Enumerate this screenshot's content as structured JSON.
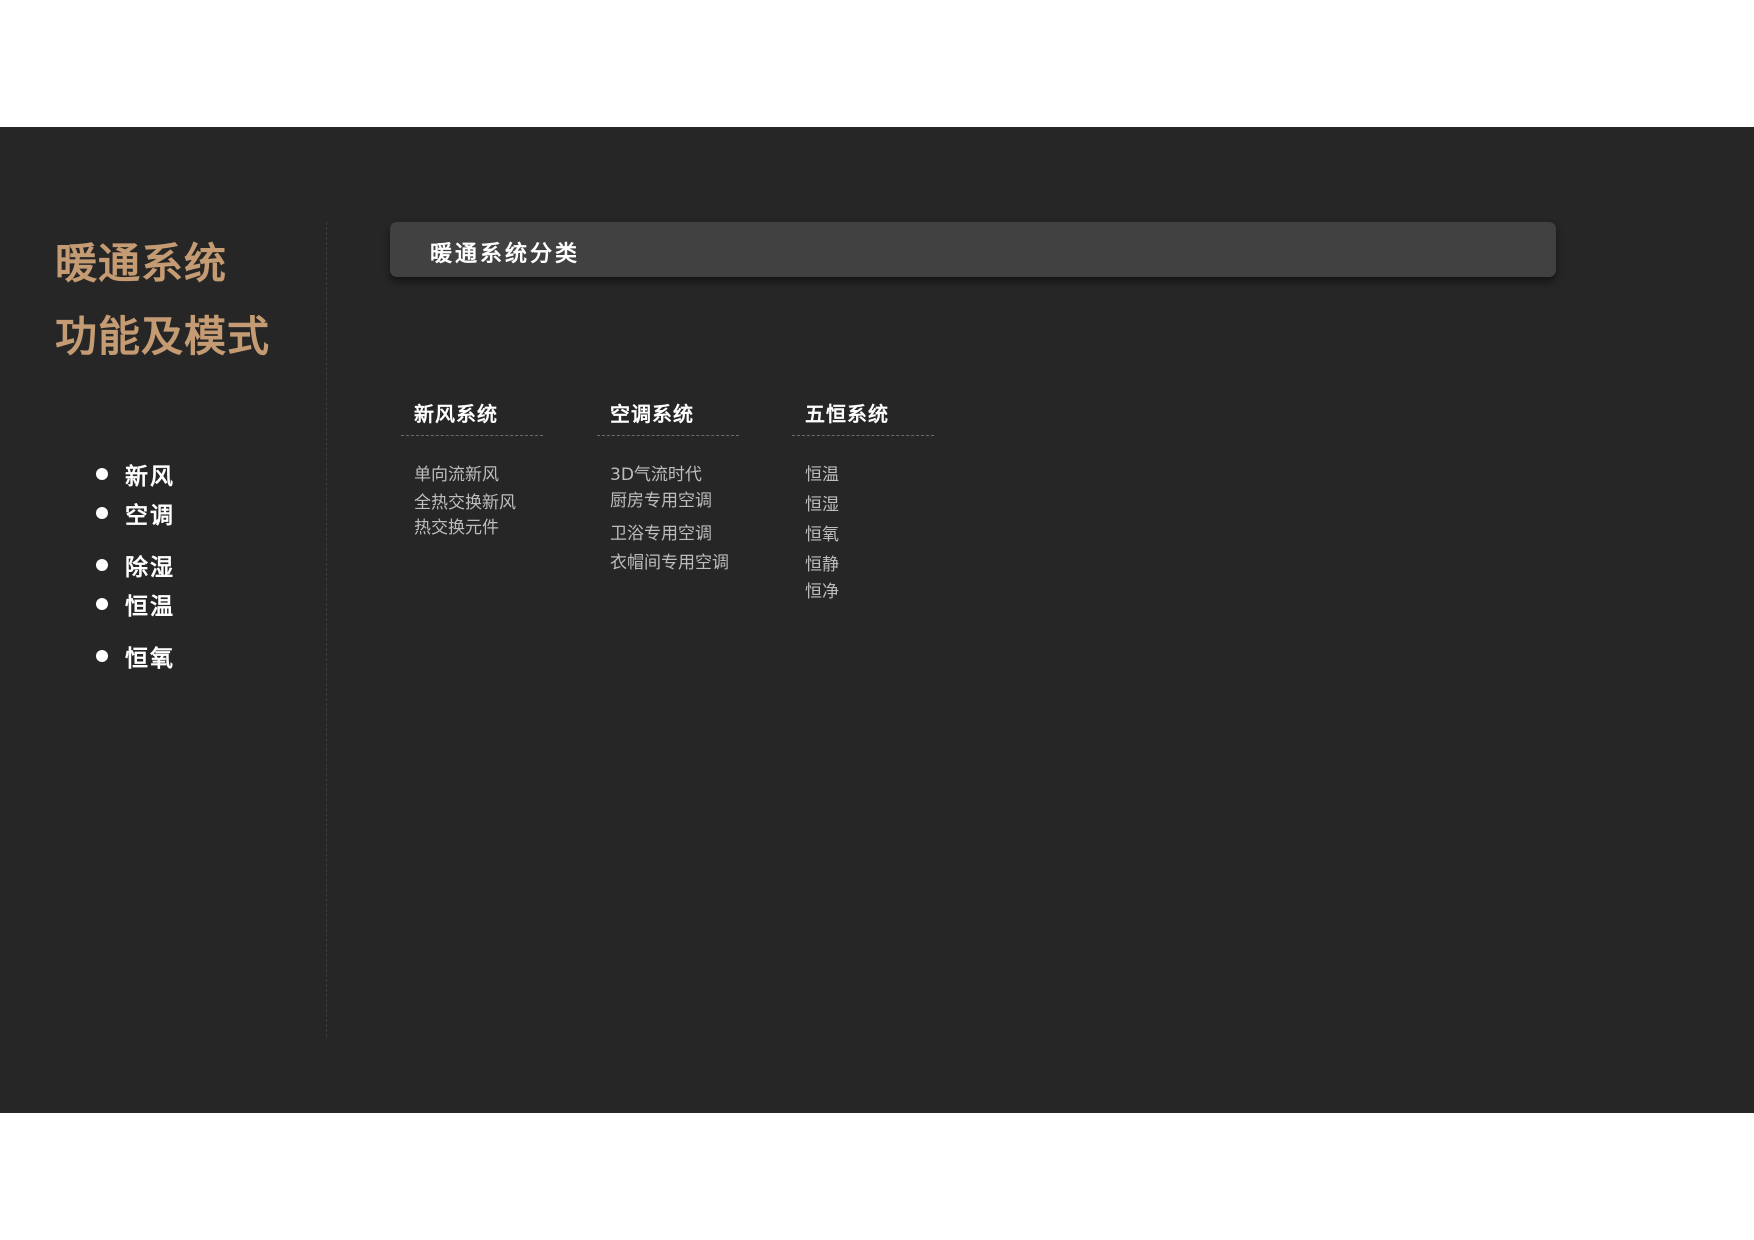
{
  "title": {
    "line1": "暖通系统",
    "line2": "功能及模式"
  },
  "bullets": [
    "新风",
    "空调",
    "除湿",
    "恒温",
    "恒氧"
  ],
  "header": {
    "label": "暖通系统分类"
  },
  "columns": [
    {
      "heading": "新风系统",
      "items": [
        "单向流新风",
        "全热交换新风",
        "热交换元件"
      ]
    },
    {
      "heading": "空调系统",
      "items": [
        "3D气流时代",
        "厨房专用空调",
        "卫浴专用空调",
        "衣帽间专用空调"
      ]
    },
    {
      "heading": "五恒系统",
      "items": [
        "恒温",
        "恒湿",
        "恒氧",
        "恒静",
        "恒净"
      ]
    }
  ],
  "colors": {
    "background": "#262626",
    "accent": "#c49b72",
    "header_bar": "#414141",
    "text_primary": "#ffffff",
    "text_secondary": "#bdbdbd"
  }
}
